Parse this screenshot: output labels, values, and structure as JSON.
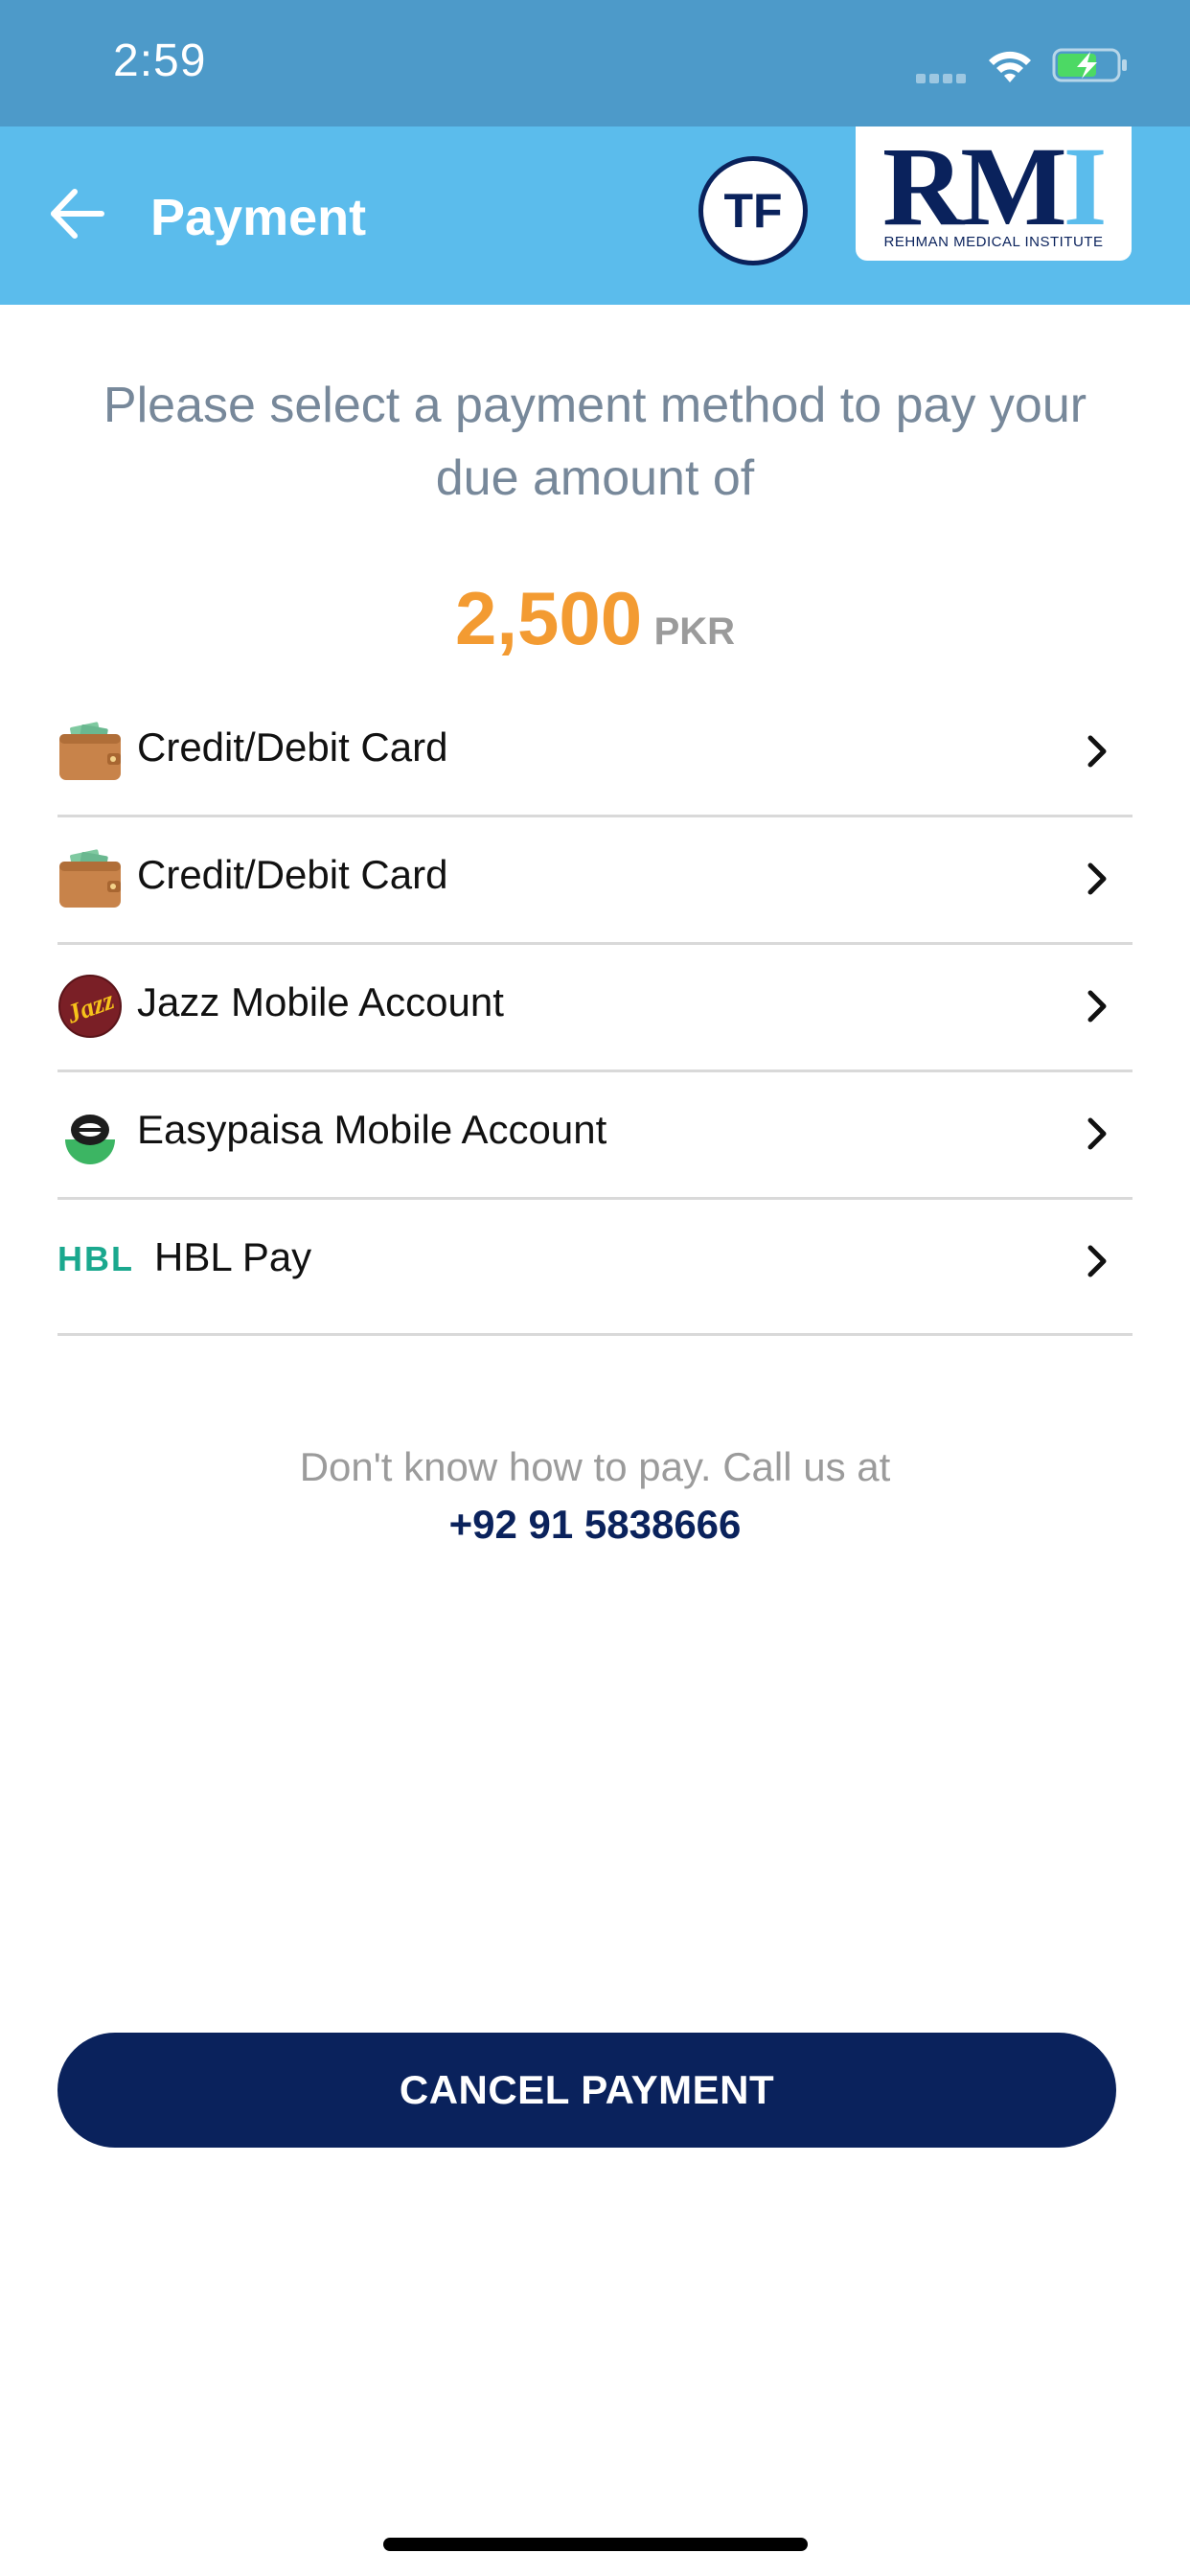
{
  "status_bar": {
    "time": "2:59",
    "signal_icon": "cellular-signal-icon",
    "wifi_icon": "wifi-icon",
    "battery_icon": "battery-charging-icon"
  },
  "header": {
    "title": "Payment",
    "back_icon": "back-arrow-icon",
    "avatar_initials": "TF",
    "logo": {
      "mark_main": "RM",
      "mark_accent": "I",
      "tagline": "REHMAN MEDICAL INSTITUTE"
    },
    "background_color": "#5bbcec"
  },
  "intro": {
    "text": "Please select a payment method to pay your due amount of"
  },
  "amount": {
    "value": "2,500",
    "currency": "PKR",
    "color": "#f39b32"
  },
  "payment_methods": [
    {
      "label": "Credit/Debit Card",
      "icon": "wallet-icon"
    },
    {
      "label": "Credit/Debit Card",
      "icon": "wallet-icon"
    },
    {
      "label": "Jazz Mobile Account",
      "icon": "jazz-logo-icon",
      "icon_text": "Jazz"
    },
    {
      "label": "Easypaisa Mobile Account",
      "icon": "easypaisa-logo-icon"
    },
    {
      "label": "HBL Pay",
      "icon": "hbl-logo-icon",
      "icon_text": "HBL"
    }
  ],
  "chevron_icon": "chevron-right-icon",
  "help": {
    "text": "Don't know how to pay. Call us at",
    "phone": "+92 91 5838666"
  },
  "cancel_button": {
    "label": "CANCEL PAYMENT",
    "color": "#0a225c"
  }
}
